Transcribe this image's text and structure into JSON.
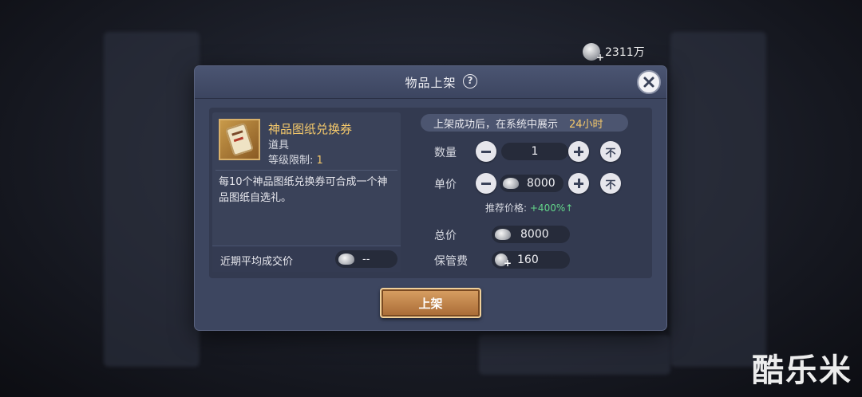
{
  "currency": {
    "icon": "silver-coin-icon",
    "amount": "2311万"
  },
  "dialog": {
    "title": "物品上架",
    "help_symbol": "?",
    "item": {
      "name": "神品图纸兑换券",
      "type": "道具",
      "level_label": "等级限制:",
      "level_value": "1",
      "description": "每10个神品图纸兑换券可合成一个神品图纸自选礼。",
      "avg_price_label": "近期平均成交价",
      "avg_price_value": "--"
    },
    "listing": {
      "info_text": "上架成功后，在系统中展示",
      "duration": "24小时",
      "quantity_label": "数量",
      "quantity_value": "1",
      "max_label": "不",
      "unit_price_label": "单价",
      "unit_price_value": "8000",
      "suggest_label": "推荐价格:",
      "suggest_value": "+400%↑",
      "total_label": "总价",
      "total_value": "8000",
      "fee_label": "保管费",
      "fee_value": "160"
    },
    "submit_label": "上架"
  },
  "watermark": "酷乐米",
  "colors": {
    "accent_gold": "#f5c96b",
    "suggest_green": "#63d68a",
    "dialog_bg": "#3d4660"
  }
}
